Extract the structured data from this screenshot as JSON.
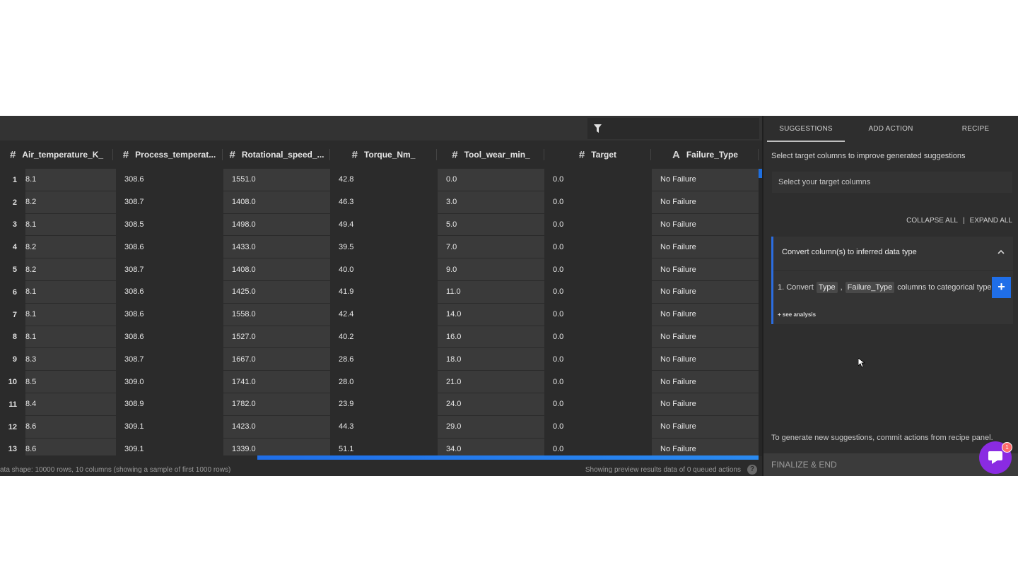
{
  "columns": [
    {
      "icon": "#",
      "name": "Air_temperature_K_"
    },
    {
      "icon": "#",
      "name": "Process_temperat..."
    },
    {
      "icon": "#",
      "name": "Rotational_speed_..."
    },
    {
      "icon": "#",
      "name": "Torque_Nm_"
    },
    {
      "icon": "#",
      "name": "Tool_wear_min_"
    },
    {
      "icon": "#",
      "name": "Target"
    },
    {
      "icon": "A",
      "name": "Failure_Type"
    }
  ],
  "rows": [
    {
      "n": "1",
      "c": [
        "8.1",
        "308.6",
        "1551.0",
        "42.8",
        "0.0",
        "0.0",
        "No Failure"
      ]
    },
    {
      "n": "2",
      "c": [
        "8.2",
        "308.7",
        "1408.0",
        "46.3",
        "3.0",
        "0.0",
        "No Failure"
      ]
    },
    {
      "n": "3",
      "c": [
        "8.1",
        "308.5",
        "1498.0",
        "49.4",
        "5.0",
        "0.0",
        "No Failure"
      ]
    },
    {
      "n": "4",
      "c": [
        "8.2",
        "308.6",
        "1433.0",
        "39.5",
        "7.0",
        "0.0",
        "No Failure"
      ]
    },
    {
      "n": "5",
      "c": [
        "8.2",
        "308.7",
        "1408.0",
        "40.0",
        "9.0",
        "0.0",
        "No Failure"
      ]
    },
    {
      "n": "6",
      "c": [
        "8.1",
        "308.6",
        "1425.0",
        "41.9",
        "11.0",
        "0.0",
        "No Failure"
      ]
    },
    {
      "n": "7",
      "c": [
        "8.1",
        "308.6",
        "1558.0",
        "42.4",
        "14.0",
        "0.0",
        "No Failure"
      ]
    },
    {
      "n": "8",
      "c": [
        "8.1",
        "308.6",
        "1527.0",
        "40.2",
        "16.0",
        "0.0",
        "No Failure"
      ]
    },
    {
      "n": "9",
      "c": [
        "8.3",
        "308.7",
        "1667.0",
        "28.6",
        "18.0",
        "0.0",
        "No Failure"
      ]
    },
    {
      "n": "10",
      "c": [
        "8.5",
        "309.0",
        "1741.0",
        "28.0",
        "21.0",
        "0.0",
        "No Failure"
      ]
    },
    {
      "n": "11",
      "c": [
        "8.4",
        "308.9",
        "1782.0",
        "23.9",
        "24.0",
        "0.0",
        "No Failure"
      ]
    },
    {
      "n": "12",
      "c": [
        "8.6",
        "309.1",
        "1423.0",
        "44.3",
        "29.0",
        "0.0",
        "No Failure"
      ]
    },
    {
      "n": "13",
      "c": [
        "8.6",
        "309.1",
        "1339.0",
        "51.1",
        "34.0",
        "0.0",
        "No Failure"
      ]
    }
  ],
  "status": {
    "shape": "ata shape: 10000 rows, 10 columns (showing a sample of first 1000 rows)",
    "preview": "Showing preview results data of 0 queued actions",
    "help": "?"
  },
  "panel": {
    "tabs": [
      "SUGGESTIONS",
      "ADD ACTION",
      "RECIPE"
    ],
    "target_hint": "Select target columns to improve generated suggestions",
    "target_placeholder": "Select your target columns",
    "collapse_all": "COLLAPSE ALL",
    "separator": "|",
    "expand_all": "EXPAND ALL",
    "card": {
      "title": "Convert column(s) to inferred data type",
      "item_prefix": "1.  Convert",
      "chip1": "Type",
      "comma": ",",
      "chip2": "Failure_Type",
      "item_suffix": "columns to categorical type.",
      "add": "+",
      "see_analysis": "+ see analysis"
    },
    "bottom_hint": "To generate new suggestions, commit actions from recipe panel.",
    "finalize": "FINALIZE & END",
    "chat_badge": "1"
  },
  "colors": {
    "accent": "#1f6ee8",
    "chat": "#8a2be2",
    "bg": "#2b2b2b"
  }
}
